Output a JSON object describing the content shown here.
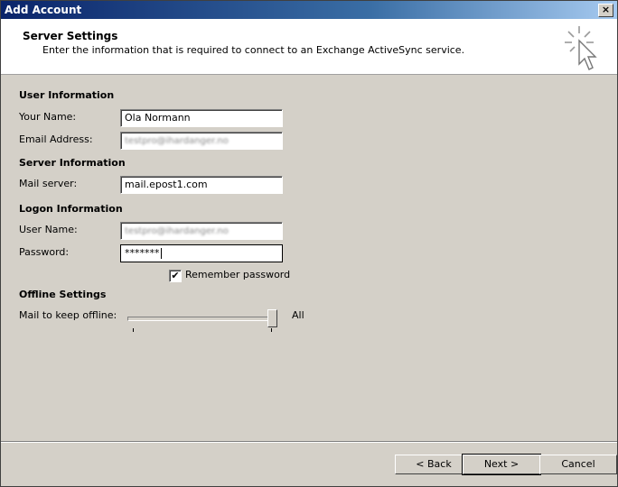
{
  "window": {
    "title": "Add Account",
    "close_label": "×"
  },
  "header": {
    "title": "Server Settings",
    "description": "Enter the information that is required to connect to an Exchange ActiveSync service."
  },
  "user_information": {
    "heading": "User Information",
    "name_label": "Your Name:",
    "name_value": "Ola Normann",
    "email_label": "Email Address:",
    "email_value": "testpro@ihardanger.no"
  },
  "server_information": {
    "heading": "Server Information",
    "mail_server_label": "Mail server:",
    "mail_server_value": "mail.epost1.com"
  },
  "logon_information": {
    "heading": "Logon Information",
    "username_label": "User Name:",
    "username_value": "testpro@ihardanger.no",
    "password_label": "Password:",
    "password_value": "*******",
    "remember_label": "Remember password",
    "remember_checked": true
  },
  "offline_settings": {
    "heading": "Offline Settings",
    "mail_offline_label": "Mail to keep offline:",
    "slider_value_label": "All",
    "slider_level": 1.0
  },
  "buttons": {
    "back": "< Back",
    "next": "Next >",
    "cancel": "Cancel"
  }
}
